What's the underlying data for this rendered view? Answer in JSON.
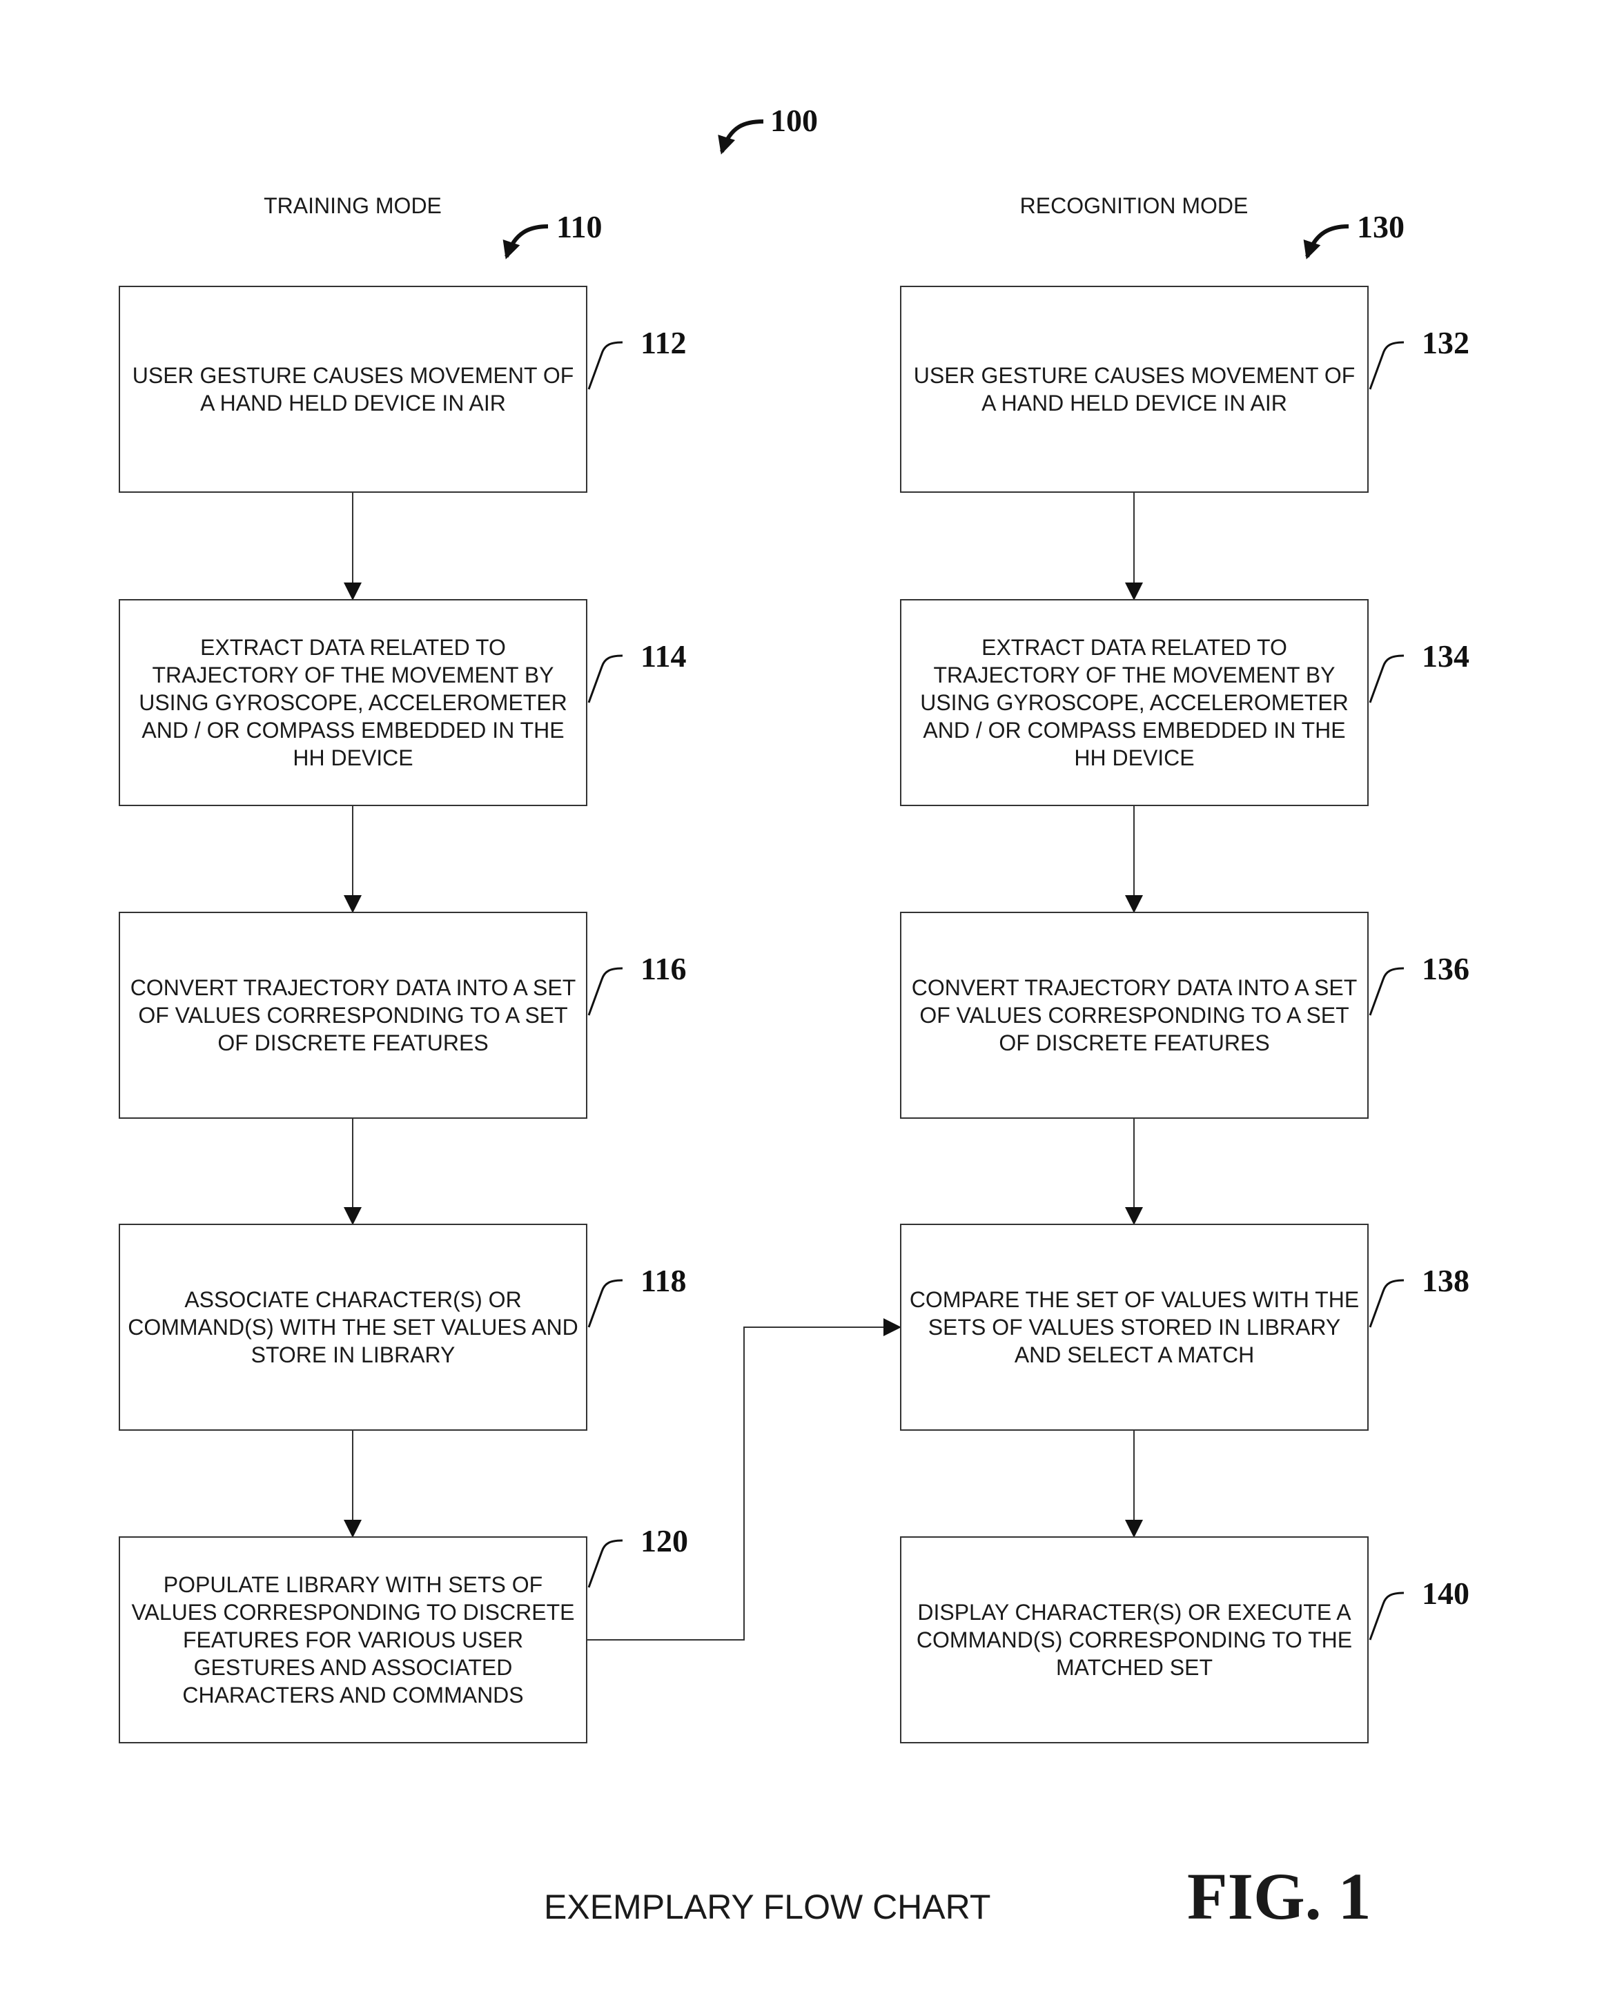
{
  "figure": {
    "ref_number": "100",
    "caption": "EXEMPLARY FLOW CHART",
    "fig_label": "FIG. 1"
  },
  "training": {
    "title": "TRAINING MODE",
    "ref_number": "110",
    "steps": [
      {
        "ref": "112",
        "text": "USER GESTURE CAUSES MOVEMENT OF A HAND HELD DEVICE IN AIR"
      },
      {
        "ref": "114",
        "text": "EXTRACT DATA RELATED TO TRAJECTORY OF THE MOVEMENT BY USING GYROSCOPE, ACCELEROMETER AND / OR COMPASS EMBEDDED IN THE HH DEVICE"
      },
      {
        "ref": "116",
        "text": "CONVERT TRAJECTORY DATA INTO A SET OF VALUES CORRESPONDING TO A SET OF DISCRETE FEATURES"
      },
      {
        "ref": "118",
        "text": "ASSOCIATE CHARACTER(S) OR COMMAND(S) WITH THE SET VALUES AND STORE IN LIBRARY"
      },
      {
        "ref": "120",
        "text": "POPULATE LIBRARY WITH SETS OF VALUES CORRESPONDING TO DISCRETE FEATURES FOR VARIOUS USER GESTURES AND ASSOCIATED CHARACTERS AND COMMANDS"
      }
    ]
  },
  "recognition": {
    "title": "RECOGNITION MODE",
    "ref_number": "130",
    "steps": [
      {
        "ref": "132",
        "text": "USER GESTURE CAUSES MOVEMENT OF A HAND HELD DEVICE IN AIR"
      },
      {
        "ref": "134",
        "text": "EXTRACT DATA RELATED TO TRAJECTORY OF THE MOVEMENT BY USING GYROSCOPE, ACCELEROMETER AND / OR COMPASS EMBEDDED IN THE HH DEVICE"
      },
      {
        "ref": "136",
        "text": "CONVERT TRAJECTORY DATA INTO A SET OF VALUES CORRESPONDING TO A SET OF DISCRETE FEATURES"
      },
      {
        "ref": "138",
        "text": "COMPARE THE SET OF VALUES WITH THE SETS OF VALUES STORED IN LIBRARY AND SELECT A MATCH"
      },
      {
        "ref": "140",
        "text": "DISPLAY CHARACTER(S) OR EXECUTE A COMMAND(S) CORRESPONDING TO THE MATCHED SET"
      }
    ]
  }
}
